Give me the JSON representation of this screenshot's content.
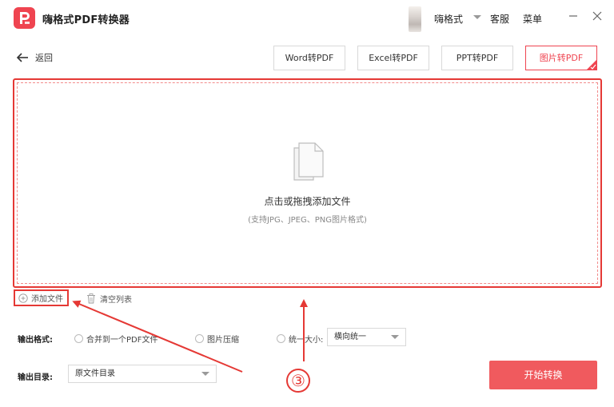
{
  "titlebar": {
    "app_title": "嗨格式PDF转换器",
    "username": "嗨格式",
    "service_label": "客服",
    "menu_label": "菜单"
  },
  "nav": {
    "back_label": "返回",
    "tabs": [
      {
        "label": "Word转PDF",
        "active": false
      },
      {
        "label": "Excel转PDF",
        "active": false
      },
      {
        "label": "PPT转PDF",
        "active": false
      },
      {
        "label": "图片转PDF",
        "active": true
      }
    ]
  },
  "dropzone": {
    "main_text": "点击或拖拽添加文件",
    "sub_text": "(支持JPG、JPEG、PNG图片格式)"
  },
  "actions": {
    "add_file_label": "添加文件",
    "clear_list_label": "清空列表"
  },
  "output": {
    "format_label": "输出格式:",
    "format_options": [
      {
        "label": "合并到一个PDF文件",
        "selected": false
      },
      {
        "label": "图片压缩",
        "selected": false
      },
      {
        "label": "统一大小:",
        "selected": false
      }
    ],
    "size_select_value": "横向统一",
    "dir_label": "输出目录:",
    "dir_select_value": "原文件目录"
  },
  "start_button_label": "开始转换",
  "annotation": {
    "step_number": "③",
    "color": "#e53935"
  },
  "colors": {
    "accent": "#ef4450",
    "start_button": "#f05a5e"
  }
}
